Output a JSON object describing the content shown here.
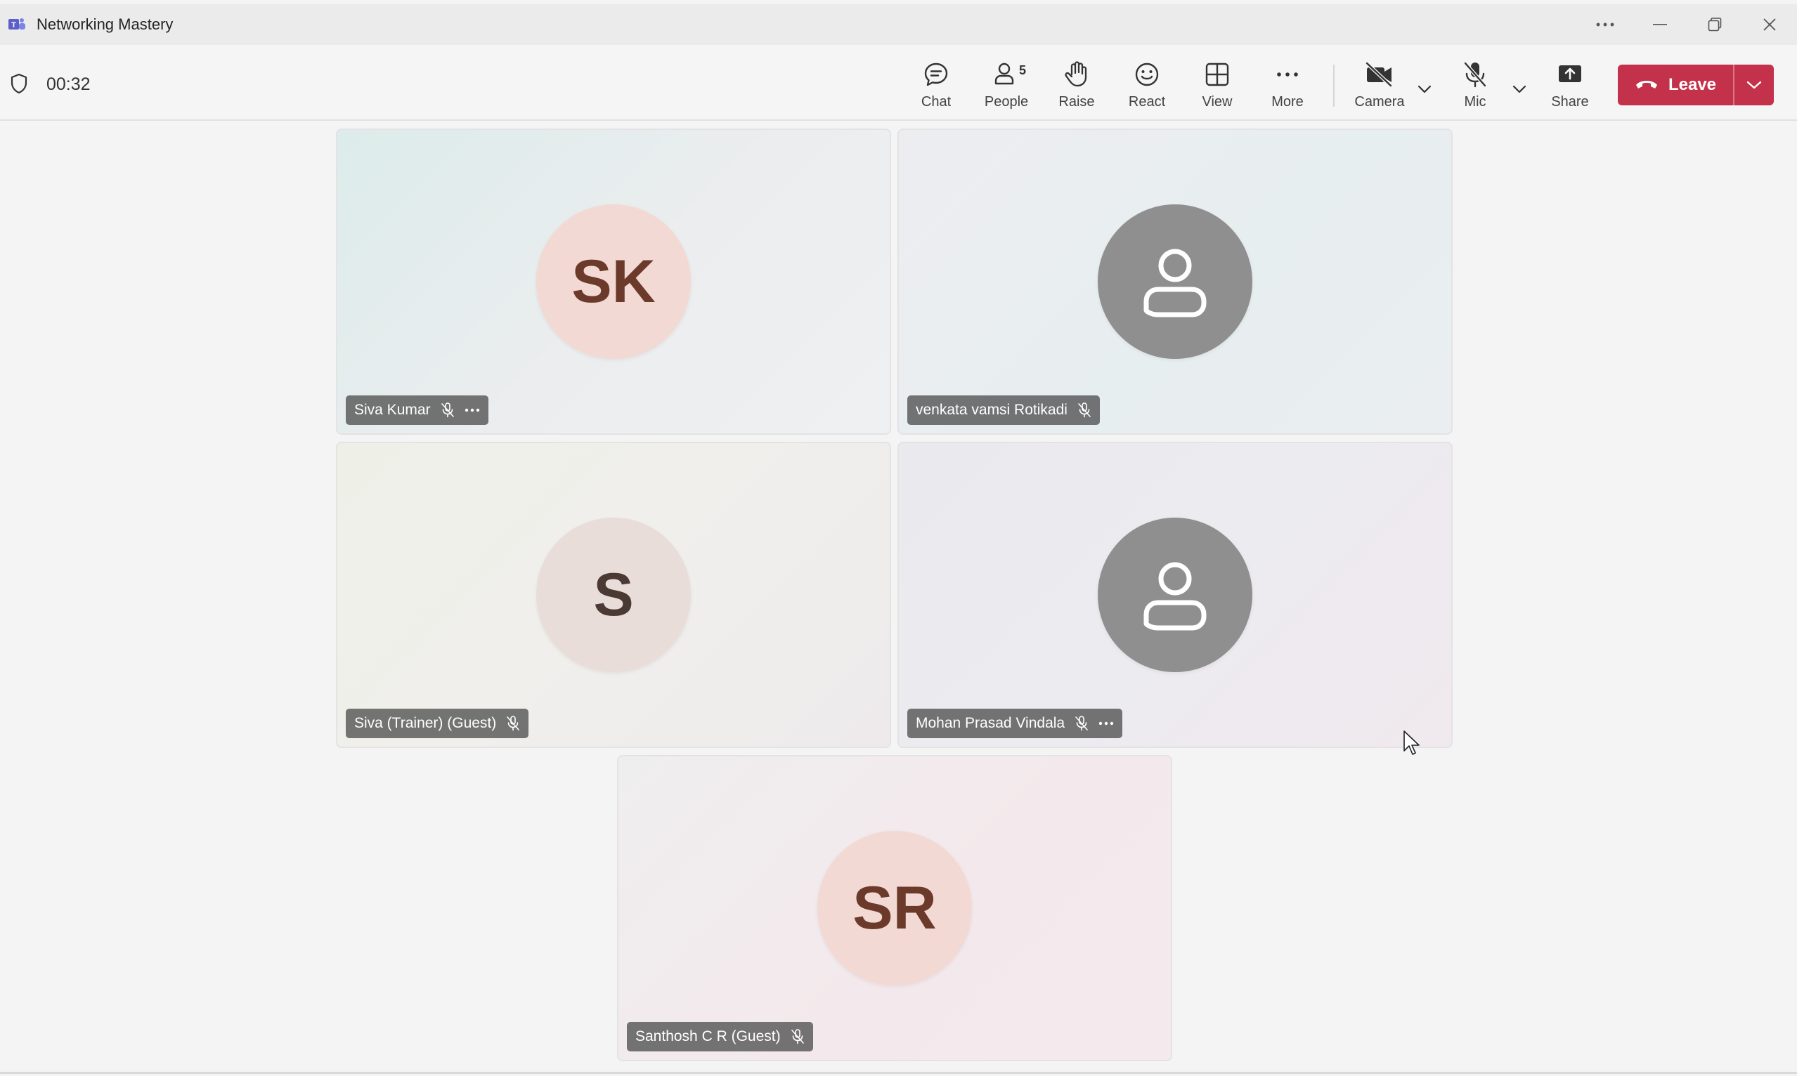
{
  "window": {
    "title": "Networking Mastery",
    "app_icon": "teams-logo-icon",
    "controls": [
      "more-icon",
      "minimize-icon",
      "restore-icon",
      "close-icon"
    ]
  },
  "meeting": {
    "timer": "00:32",
    "toolbar": {
      "chat": "Chat",
      "people": "People",
      "people_count": "5",
      "raise": "Raise",
      "react": "React",
      "view": "View",
      "more": "More",
      "camera": "Camera",
      "mic": "Mic",
      "share": "Share",
      "leave": "Leave"
    },
    "accent_color": "#c4314b"
  },
  "participants": [
    {
      "name": "Siva Kumar",
      "initials": "SK",
      "muted": true,
      "has_more": true
    },
    {
      "name": "venkata vamsi Rotikadi",
      "initials": "",
      "muted": true,
      "has_more": false
    },
    {
      "name": "Siva (Trainer) (Guest)",
      "initials": "S",
      "muted": true,
      "has_more": false
    },
    {
      "name": "Mohan Prasad Vindala",
      "initials": "",
      "muted": true,
      "has_more": true
    },
    {
      "name": "Santhosh C R (Guest)",
      "initials": "SR",
      "muted": true,
      "has_more": false
    }
  ]
}
